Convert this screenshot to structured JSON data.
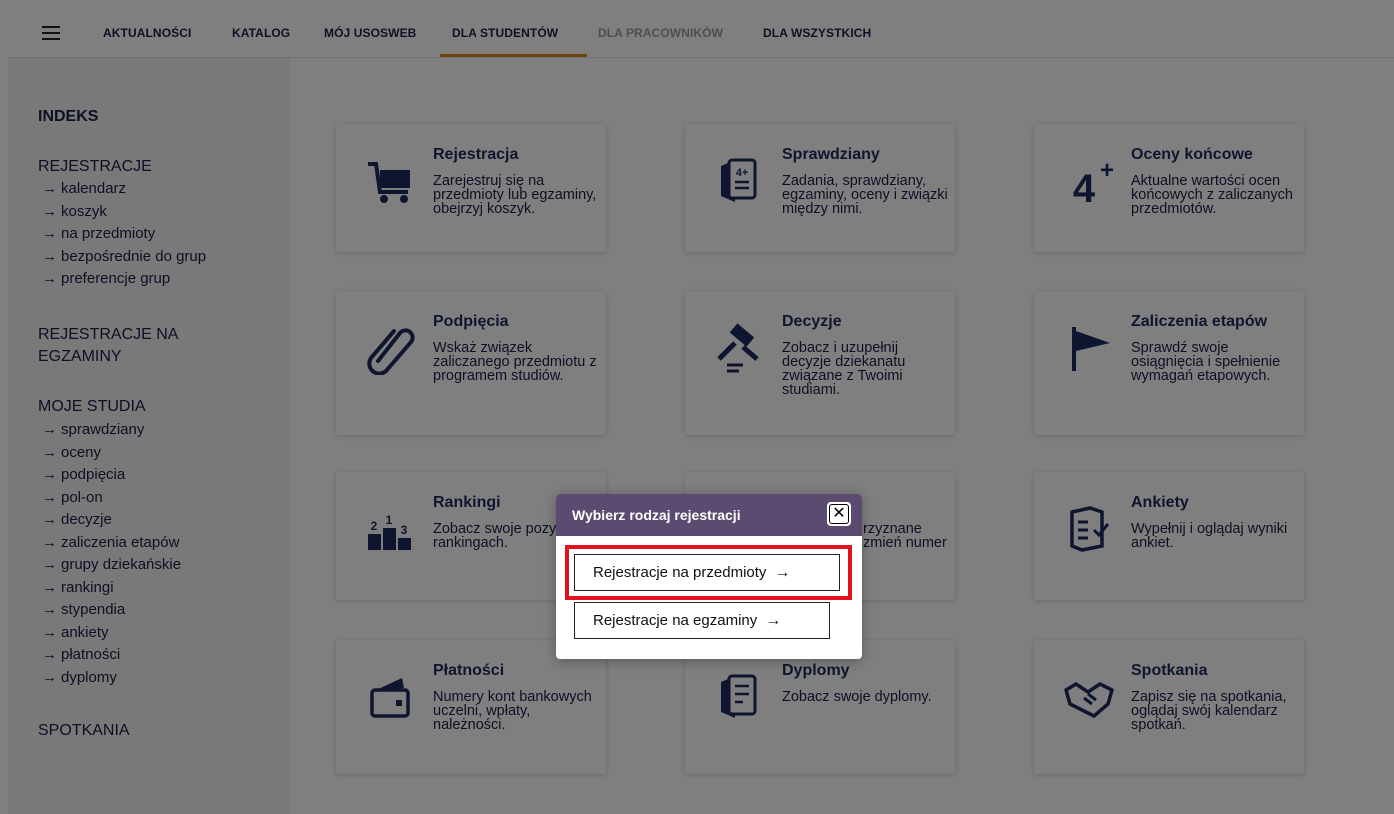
{
  "nav": {
    "items": [
      {
        "label": "AKTUALNOŚCI",
        "disabled": false
      },
      {
        "label": "KATALOG",
        "disabled": false
      },
      {
        "label": "MÓJ USOSWEB",
        "disabled": false
      },
      {
        "label": "DLA STUDENTÓW",
        "disabled": false,
        "active": true
      },
      {
        "label": "DLA PRACOWNIKÓW",
        "disabled": true
      },
      {
        "label": "DLA WSZYSTKICH",
        "disabled": false
      }
    ],
    "accent_color": "#d88a18"
  },
  "sidebar": {
    "indeks": "INDEKS",
    "rejestracje": "REJESTRACJE",
    "rejestracje_links": [
      "kalendarz",
      "koszyk",
      "na przedmioty",
      "bezpośrednie do grup",
      "preferencje grup"
    ],
    "rejestracje_egz": "REJESTRACJE NA EGZAMINY",
    "moje_studia": "MOJE STUDIA",
    "moje_studia_links": [
      "sprawdziany",
      "oceny",
      "podpięcia",
      "pol-on",
      "decyzje",
      "zaliczenia etapów",
      "grupy dziekańskie",
      "rankingi",
      "stypendia",
      "ankiety",
      "płatności",
      "dyplomy"
    ],
    "spotkania": "SPOTKANIA",
    "arrow": "→"
  },
  "tiles": [
    {
      "icon": "cart-icon",
      "title": "Rejestracja",
      "desc": "Zarejestruj się na przedmioty lub egzaminy, obejrzyj koszyk."
    },
    {
      "icon": "exam-sheet-icon",
      "title": "Sprawdziany",
      "desc": "Zadania, sprawdziany, egzaminy, oceny i związki między nimi."
    },
    {
      "icon": "grade-icon",
      "title": "Oceny końcowe",
      "desc": "Aktualne wartości ocen końcowych z zaliczanych przedmiotów."
    },
    {
      "icon": "paperclip-icon",
      "title": "Podpięcia",
      "desc": "Wskaż związek zaliczanego przedmiotu z programem studiów."
    },
    {
      "icon": "gavel-icon",
      "title": "Decyzje",
      "desc": "Zobacz i uzupełnij decyzje dziekanatu związane z Twoimi studiami."
    },
    {
      "icon": "flag-icon",
      "title": "Zaliczenia etapów",
      "desc": "Sprawdź swoje osiągnięcia i spełnienie wymagań etapowych."
    },
    {
      "icon": "podium-icon",
      "title": "Rankingi",
      "desc": "Zobacz swoje pozycje w rankingach."
    },
    {
      "icon": "scholarship-icon",
      "title": "",
      "desc": "rzyznane zmień numer"
    },
    {
      "icon": "survey-icon",
      "title": "Ankiety",
      "desc": "Wypełnij i oglądaj wyniki ankiet."
    },
    {
      "icon": "wallet-icon",
      "title": "Płatności",
      "desc": "Numery kont bankowych uczelni, wpłaty, należności."
    },
    {
      "icon": "diploma-icon",
      "title": "Dyplomy",
      "desc": "Zobacz swoje dyplomy."
    },
    {
      "icon": "handshake-icon",
      "title": "Spotkania",
      "desc": "Zapisz się na spotkania, oglądaj swój kalendarz spotkań."
    }
  ],
  "modal": {
    "title": "Wybierz rodzaj rejestracji",
    "close_symbol": "✕",
    "option_przedmioty": "Rejestracje na przedmioty",
    "option_egzaminy": "Rejestracje na egzaminy",
    "arrow": "→",
    "header_color": "#5c4b70",
    "highlight_color": "#e0121e"
  }
}
